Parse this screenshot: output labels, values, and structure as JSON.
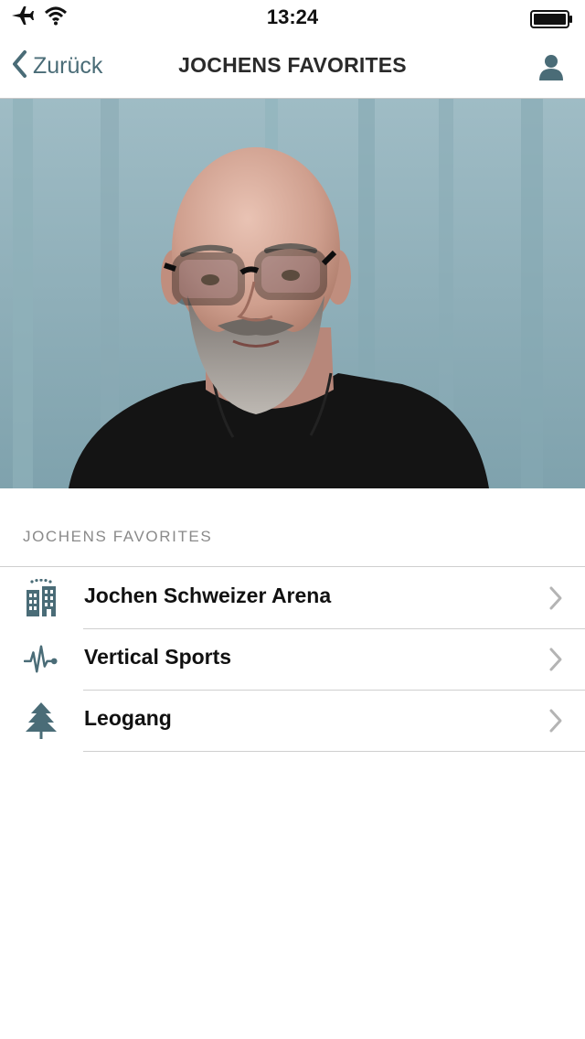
{
  "status_bar": {
    "time": "13:24",
    "icons": [
      "airplane-icon",
      "wifi-icon",
      "battery-icon"
    ]
  },
  "nav": {
    "back_label": "Zurück",
    "title": "JOCHENS FAVORITES",
    "profile_icon": "person-icon"
  },
  "hero": {
    "image": "portrait photo of a bald man with glasses and grey beard"
  },
  "section": {
    "header": "JOCHENS FAVORITES"
  },
  "favorites": [
    {
      "label": "Jochen Schweizer Arena",
      "icon": "hotel-building-icon"
    },
    {
      "label": "Vertical Sports",
      "icon": "pulse-line-icon"
    },
    {
      "label": "Leogang",
      "icon": "tree-icon"
    }
  ],
  "colors": {
    "accent": "#4a6c77",
    "text": "#111111",
    "section_header": "#8a8a8a",
    "separator": "#cfcfcf"
  }
}
